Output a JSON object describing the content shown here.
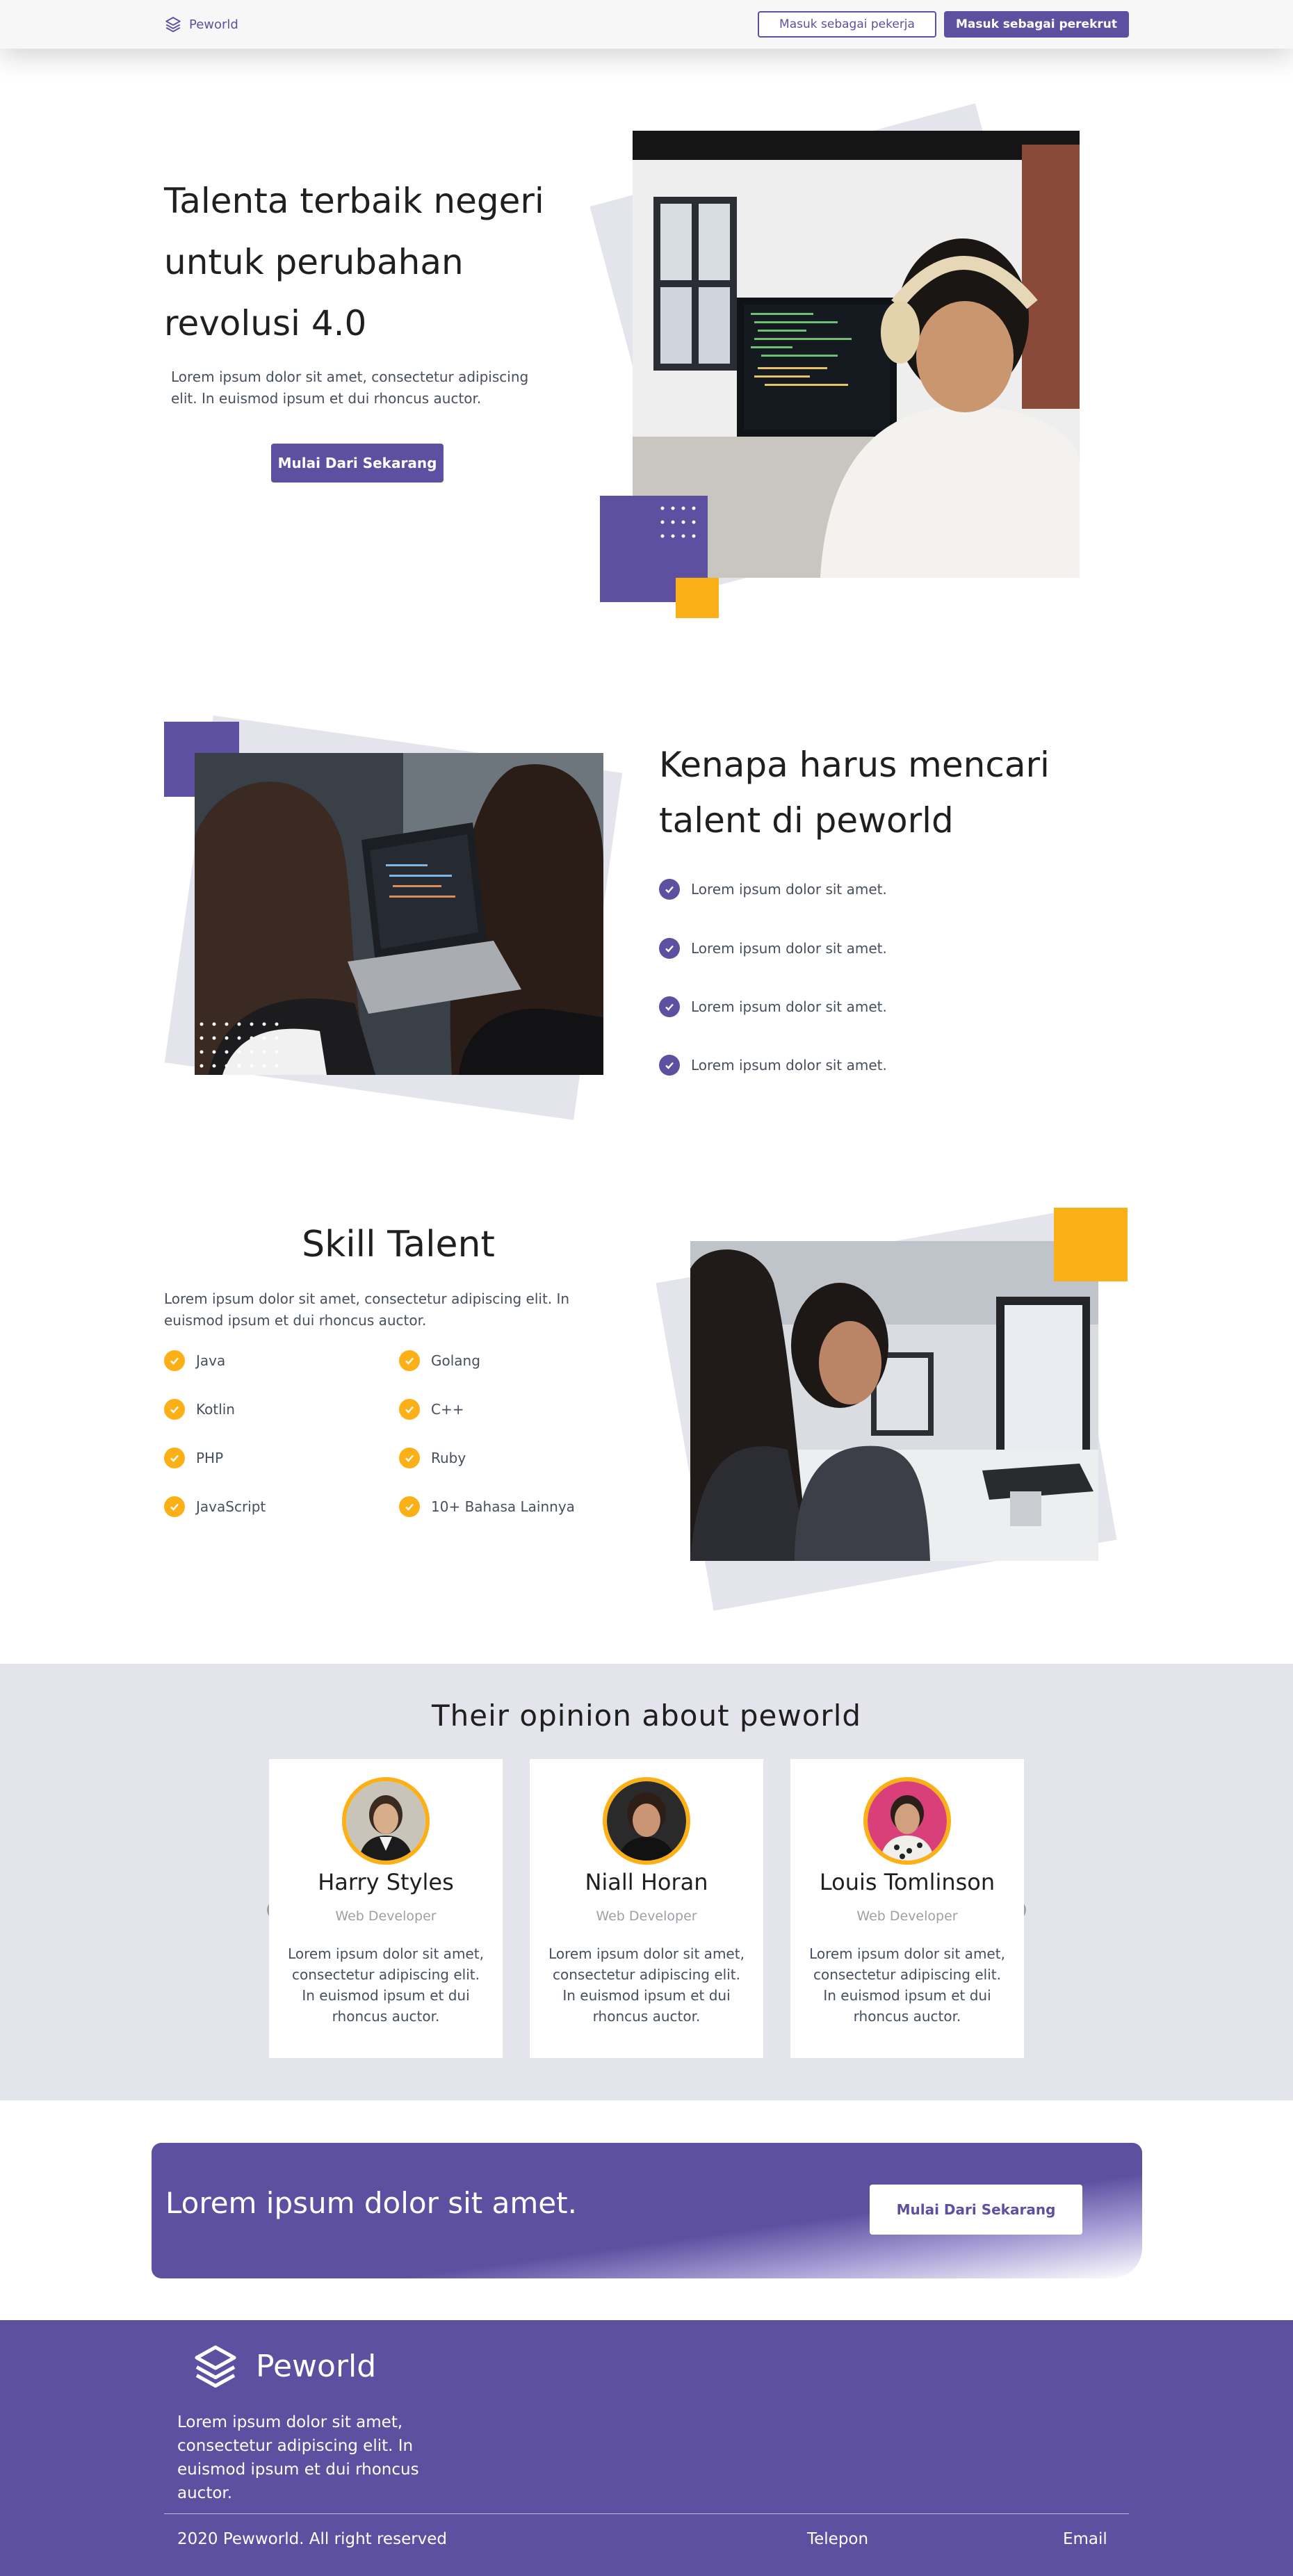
{
  "nav": {
    "brand": "Peworld",
    "login_worker": "Masuk sebagai pekerja",
    "login_recruiter": "Masuk sebagai perekrut"
  },
  "hero": {
    "title": "Talenta terbaik negeri untuk perubahan revolusi 4.0",
    "description": "Lorem ipsum dolor sit amet, consectetur adipiscing elit. In euismod ipsum et dui rhoncus auctor.",
    "cta": "Mulai Dari Sekarang"
  },
  "why": {
    "title": "Kenapa harus mencari talent di peworld",
    "points": [
      "Lorem ipsum dolor sit amet.",
      "Lorem ipsum dolor sit amet.",
      "Lorem ipsum dolor sit amet.",
      "Lorem ipsum dolor sit amet."
    ]
  },
  "skills": {
    "title": "Skill Talent",
    "description": "Lorem ipsum dolor sit amet, consectetur adipiscing elit. In euismod ipsum et dui rhoncus auctor.",
    "left": [
      "Java",
      "Kotlin",
      "PHP",
      "JavaScript"
    ],
    "right": [
      "Golang",
      "C++",
      "Ruby",
      "10+ Bahasa Lainnya"
    ]
  },
  "testimonials": {
    "title": "Their opinion about peworld",
    "cards": [
      {
        "name": "Harry Styles",
        "role": "Web Developer",
        "text": "Lorem ipsum dolor sit amet, consectetur adipiscing elit. In euismod ipsum et dui rhoncus auctor."
      },
      {
        "name": "Niall Horan",
        "role": "Web Developer",
        "text": "Lorem ipsum dolor sit amet, consectetur adipiscing elit. In euismod ipsum et dui rhoncus auctor."
      },
      {
        "name": "Louis Tomlinson",
        "role": "Web Developer",
        "text": "Lorem ipsum dolor sit amet, consectetur adipiscing elit. In euismod ipsum et dui rhoncus auctor."
      }
    ]
  },
  "cta": {
    "text": "Lorem ipsum dolor sit amet.",
    "button": "Mulai Dari Sekarang"
  },
  "footer": {
    "brand": "Peworld",
    "description": "Lorem ipsum dolor sit amet, consectetur adipiscing elit. In euismod ipsum et dui rhoncus auctor.",
    "copyright": "2020 Pewworld. All right reserved",
    "phone": "Telepon",
    "email": "Email"
  },
  "colors": {
    "primary": "#5e50a1",
    "accent": "#fbb017",
    "muted_bg": "#e4e5ec"
  },
  "icons": [
    "layers-logo-icon",
    "check-circle-icon",
    "chevron-left-icon",
    "chevron-right-icon"
  ]
}
